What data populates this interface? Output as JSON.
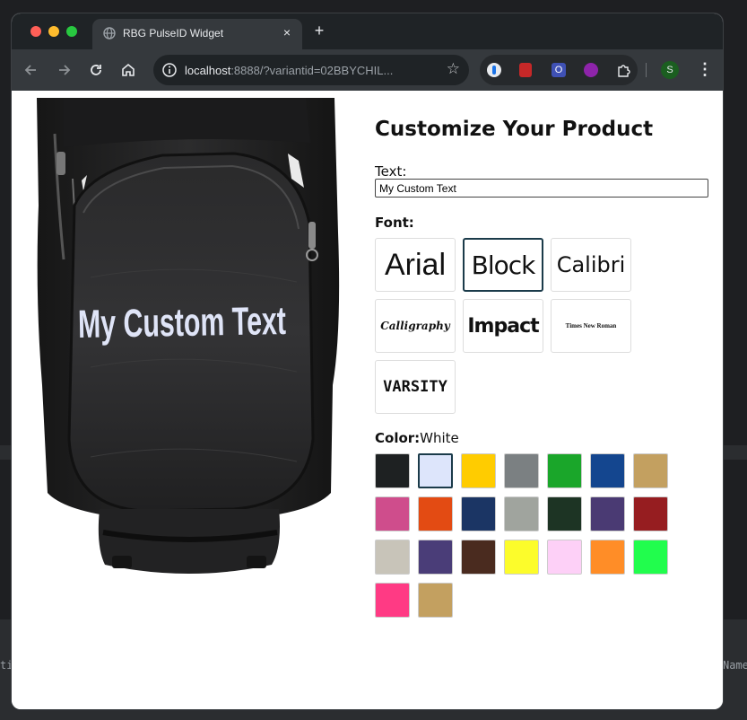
{
  "browser": {
    "tab_title": "RBG PulseID Widget",
    "tab_close": "×",
    "new_tab": "+",
    "url_host": "localhost",
    "url_rest": ":8888/?variantid=02BBYCHIL...",
    "profile_initial": "S"
  },
  "background": {
    "left_fragment": "ti",
    "right_fragment": "Name"
  },
  "product": {
    "preview_text": "My Custom Text",
    "preview_text_color": "#dfe4f7"
  },
  "customizer": {
    "heading": "Customize Your Product",
    "text_label": "Text:",
    "text_value": "My Custom Text",
    "font_label": "Font:",
    "fonts": [
      {
        "name": "Arial",
        "selected": false
      },
      {
        "name": "Block",
        "selected": true
      },
      {
        "name": "Calibri",
        "selected": false
      },
      {
        "name": "Calligraphy",
        "selected": false
      },
      {
        "name": "Impact",
        "selected": false
      },
      {
        "name": "Times New Roman",
        "selected": false
      },
      {
        "name": "VARSITY",
        "selected": false
      }
    ],
    "color_label": "Color:",
    "color_value": "White",
    "colors": [
      "#1e2122",
      "#dde5fb",
      "#ffcc00",
      "#7b8082",
      "#1aa62a",
      "#14468f",
      "#c3a060",
      "#cf4d8c",
      "#e34b13",
      "#1b3564",
      "#a0a49e",
      "#1d3424",
      "#4a3a73",
      "#961d20",
      "#c8c4b9",
      "#4a3d78",
      "#4a2b1f",
      "#fcfc2b",
      "#fdd0f7",
      "#ff8d27",
      "#21fd4d",
      "#ff3a84",
      "#c3a060"
    ],
    "selected_color_index": 1
  }
}
